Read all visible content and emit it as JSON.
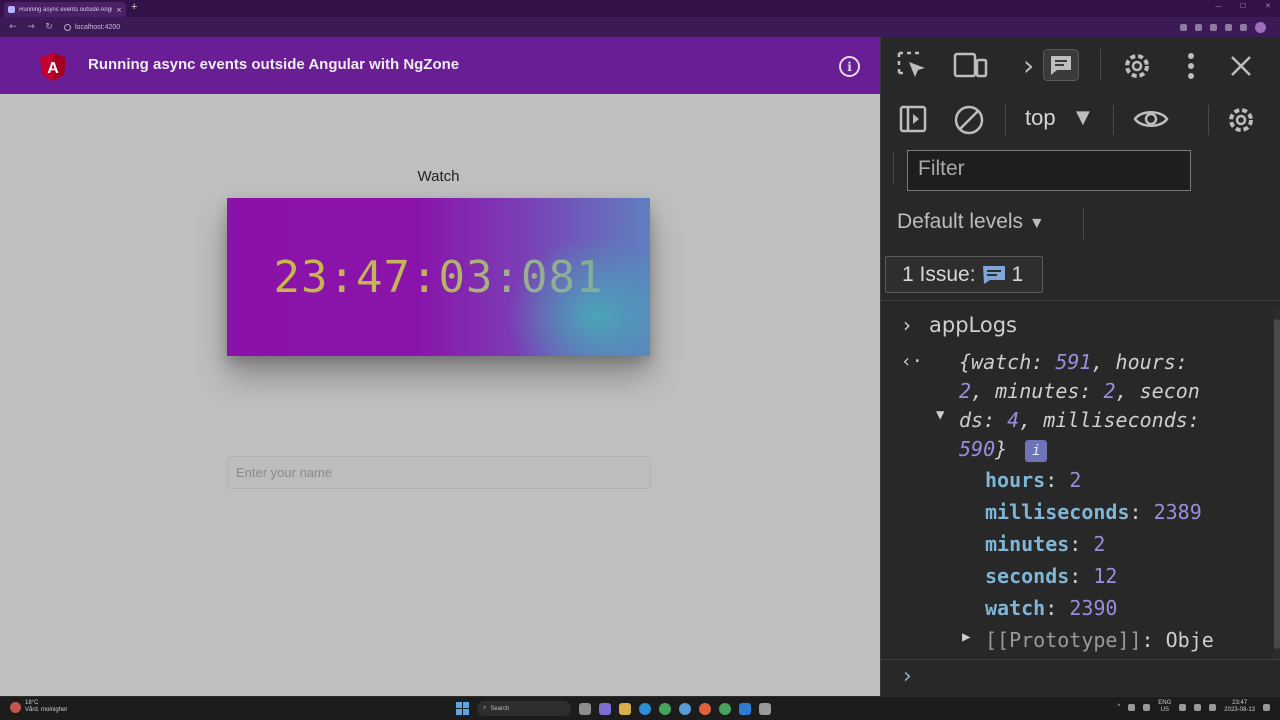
{
  "browser": {
    "tab_title": "Running async events outside Angular with NgZone",
    "tab_close": "×",
    "new_tab": "+",
    "url": "localhost:4200"
  },
  "app": {
    "header_title": "Running async events outside Angular with NgZone",
    "logo_letter": "A",
    "info_glyph": "i",
    "watch_label": "Watch",
    "watch_time": "23:47:03:081",
    "name_placeholder": "Enter your name",
    "colors": {
      "header": "#6a1e96",
      "page": "#bfbfbf"
    }
  },
  "devtools": {
    "context": "top",
    "filter_placeholder": "Filter",
    "levels": "Default levels",
    "issues_label": "1 Issue:",
    "issues_count": "1",
    "log_name": "appLogs",
    "summary": {
      "line1_a": "{watch: ",
      "watch": "591",
      "line1_b": ", hours:",
      "hours": "2",
      "line2_a": ", minutes: ",
      "minutes": "2",
      "line2_b": ", secon",
      "line3_a": "ds: ",
      "seconds": "4",
      "line3_b": ", milliseconds:",
      "milliseconds": "590",
      "line4_b": "}"
    },
    "properties": [
      {
        "key": "hours",
        "value": "2"
      },
      {
        "key": "milliseconds",
        "value": "2389"
      },
      {
        "key": "minutes",
        "value": "2"
      },
      {
        "key": "seconds",
        "value": "12"
      },
      {
        "key": "watch",
        "value": "2390"
      }
    ],
    "prototype_key": "[[Prototype]]",
    "prototype_value": "Obje"
  },
  "taskbar": {
    "temperature": "18°C",
    "weather": "Vård. molnighet",
    "search": "Search",
    "lang_top": "ENG",
    "lang_bottom": "US",
    "time": "23:47",
    "date": "2023-08-13"
  }
}
